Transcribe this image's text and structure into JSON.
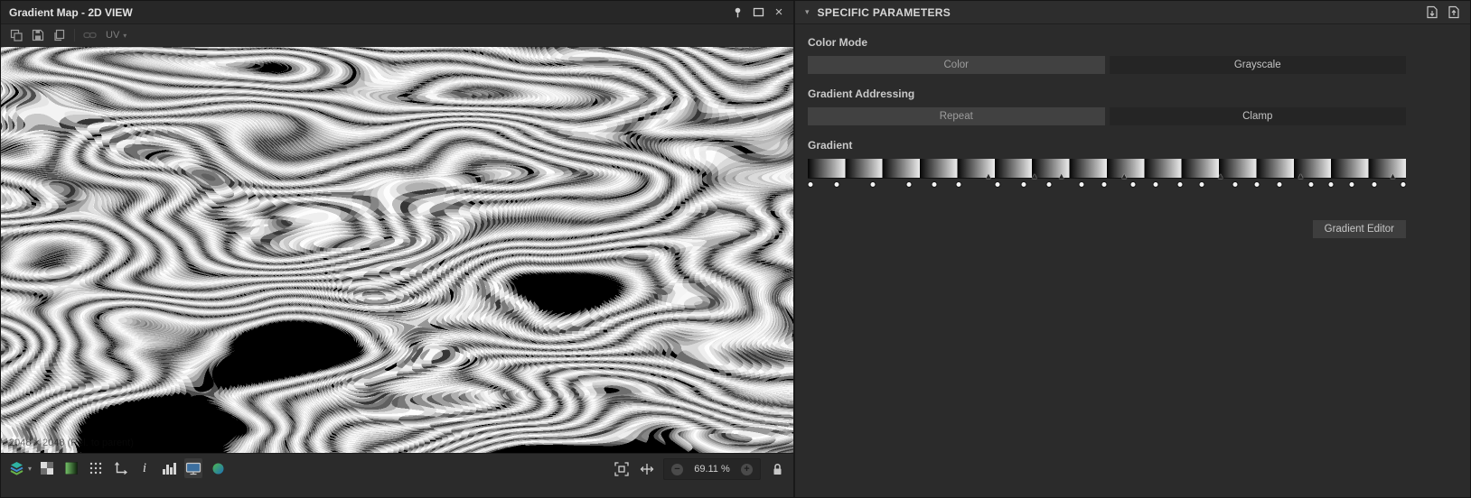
{
  "icons": {
    "close": "×",
    "minus": "−",
    "plus": "+",
    "info": "i",
    "triangle": "▲",
    "uv_chevron": "▾",
    "layers_chevron": "▾",
    "header_chevron": "▾"
  },
  "left_panel": {
    "title": "Gradient Map - 2D VIEW",
    "toolbar": {
      "uv_label": "UV"
    },
    "canvas_caption": "2048 × 2048 (Rel. to parent)",
    "statusbar": {
      "zoom_value": "69.11 %"
    }
  },
  "right_panel": {
    "title": "SPECIFIC PARAMETERS",
    "color_mode": {
      "label": "Color Mode",
      "options": [
        {
          "label": "Color",
          "selected": true
        },
        {
          "label": "Grayscale",
          "selected": false
        }
      ]
    },
    "gradient_addressing": {
      "label": "Gradient Addressing",
      "options": [
        {
          "label": "Repeat",
          "selected": true
        },
        {
          "label": "Clamp",
          "selected": false
        }
      ]
    },
    "gradient": {
      "label": "Gradient",
      "editor_button": "Gradient Editor",
      "segments": 16,
      "markers": [
        {
          "pos": 0.5,
          "type": "circle"
        },
        {
          "pos": 4.8,
          "type": "circle"
        },
        {
          "pos": 10.9,
          "type": "circle"
        },
        {
          "pos": 16.9,
          "type": "circle"
        },
        {
          "pos": 21.2,
          "type": "circle"
        },
        {
          "pos": 25.3,
          "type": "circle"
        },
        {
          "pos": 30.2,
          "type": "tri"
        },
        {
          "pos": 31.7,
          "type": "circle"
        },
        {
          "pos": 36.1,
          "type": "circle"
        },
        {
          "pos": 37.9,
          "type": "tri"
        },
        {
          "pos": 40.4,
          "type": "circle"
        },
        {
          "pos": 42.4,
          "type": "tri"
        },
        {
          "pos": 45.7,
          "type": "circle"
        },
        {
          "pos": 49.5,
          "type": "circle"
        },
        {
          "pos": 52.9,
          "type": "tri"
        },
        {
          "pos": 54.4,
          "type": "circle"
        },
        {
          "pos": 58.2,
          "type": "circle"
        },
        {
          "pos": 62.3,
          "type": "circle"
        },
        {
          "pos": 65.8,
          "type": "circle"
        },
        {
          "pos": 69.0,
          "type": "tri"
        },
        {
          "pos": 71.5,
          "type": "circle"
        },
        {
          "pos": 75.1,
          "type": "circle"
        },
        {
          "pos": 78.9,
          "type": "circle"
        },
        {
          "pos": 82.4,
          "type": "tri"
        },
        {
          "pos": 84.2,
          "type": "circle"
        },
        {
          "pos": 87.4,
          "type": "circle"
        },
        {
          "pos": 91.0,
          "type": "circle"
        },
        {
          "pos": 94.7,
          "type": "circle"
        },
        {
          "pos": 97.8,
          "type": "tri"
        },
        {
          "pos": 99.5,
          "type": "circle"
        }
      ]
    }
  },
  "colors": {
    "panel_bg": "#2b2b2b",
    "selected_button": "#414141",
    "unselected_button": "#252525",
    "display_screen_blue": "#3c6f9f",
    "gradient_dark": "#060606",
    "gradient_light": "#ededed"
  }
}
